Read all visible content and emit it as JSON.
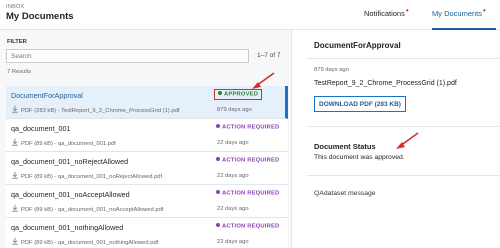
{
  "header": {
    "kicker": "INBOX",
    "title": "My Documents",
    "tabs": [
      {
        "label": "Notifications",
        "active": false
      },
      {
        "label": "My Documents",
        "active": true
      }
    ],
    "tab_dot": "•"
  },
  "filter": {
    "label": "FILTER",
    "search_placeholder": "Search",
    "pager": "1–7 of 7",
    "results": "7 Results"
  },
  "documents": [
    {
      "title": "DocumentForApproval",
      "file": "PDF (283 kB) - TestReport_9_2_Chrome_ProcessGrid (1).pdf",
      "status": "APPROVED",
      "time": "879 days ago"
    },
    {
      "title": "qa_document_001",
      "file": "PDF (89 kB) - qa_document_001.pdf",
      "status": "ACTION REQUIRED",
      "time": "22 days ago"
    },
    {
      "title": "qa_document_001_noRejectAllowed",
      "file": "PDF (89 kB) - qa_document_001_noRejectAllowed.pdf",
      "status": "ACTION REQUIRED",
      "time": "22 days ago"
    },
    {
      "title": "qa_document_001_noAcceptAllowed",
      "file": "PDF (89 kB) - qa_document_001_noAcceptAllowed.pdf",
      "status": "ACTION REQUIRED",
      "time": "22 days ago"
    },
    {
      "title": "qa_document_001_nothingAllowed",
      "file": "PDF (89 kB) - qa_document_001_nothingAllowed.pdf",
      "status": "ACTION REQUIRED",
      "time": "22 days ago"
    }
  ],
  "detail": {
    "title": "DocumentForApproval",
    "time": "879 days ago",
    "file": "TestReport_9_2_Chrome_ProcessGrid (1).pdf",
    "download_label": "DOWNLOAD PDF (283 KB)",
    "status_heading": "Document Status",
    "status_text": "This document was approved.",
    "message": "QAdataset message"
  },
  "colors": {
    "accent": "#1a73c8",
    "approved": "#2e7d32",
    "action_required": "#8e3fb5",
    "annotation": "#d32f2f",
    "notification_dot": "#d2252b"
  }
}
